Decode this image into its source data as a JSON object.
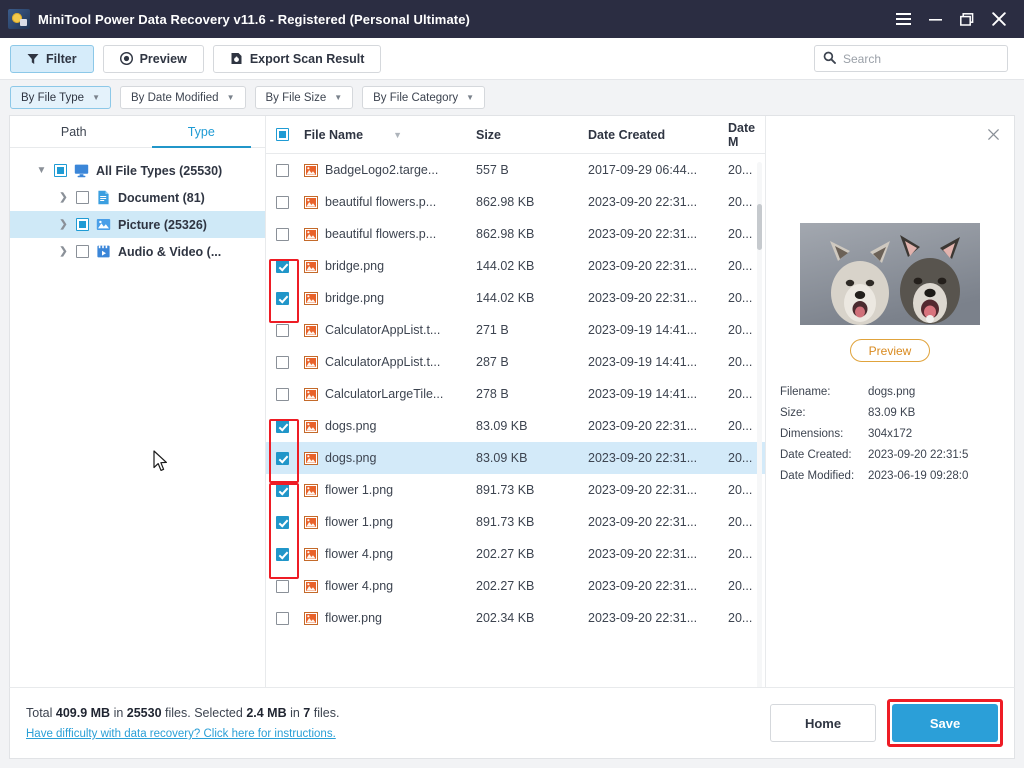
{
  "window": {
    "title": "MiniTool Power Data Recovery v11.6 - Registered (Personal Ultimate)",
    "app_icon": "app-logo-icon",
    "controls": [
      {
        "name": "menu-button",
        "icon": "hamburger-icon"
      },
      {
        "name": "minimize-button",
        "icon": "minimize-icon"
      },
      {
        "name": "restore-button",
        "icon": "restore-icon"
      },
      {
        "name": "close-button",
        "icon": "close-icon"
      }
    ]
  },
  "toolbar": {
    "filter_label": "Filter",
    "preview_label": "Preview",
    "export_label": "Export Scan Result",
    "search_placeholder": "Search",
    "search_value": ""
  },
  "filterbar": {
    "items": [
      {
        "label": "By File Type",
        "active": true
      },
      {
        "label": "By Date Modified",
        "active": false
      },
      {
        "label": "By File Size",
        "active": false
      },
      {
        "label": "By File Category",
        "active": false
      }
    ]
  },
  "tree": {
    "tabs": [
      {
        "label": "Path",
        "active": false
      },
      {
        "label": "Type",
        "active": true
      }
    ],
    "items": [
      {
        "label": "All File Types (25530)",
        "depth": 0,
        "check": "partial",
        "twisty": "down",
        "icon": "monitor-icon",
        "selected": false
      },
      {
        "label": "Document (81)",
        "depth": 1,
        "check": "unchecked",
        "twisty": "right",
        "icon": "document-icon",
        "selected": false
      },
      {
        "label": "Picture (25326)",
        "depth": 1,
        "check": "partial",
        "twisty": "right",
        "icon": "picture-icon",
        "selected": true
      },
      {
        "label": "Audio & Video (...",
        "depth": 1,
        "check": "unchecked",
        "twisty": "right",
        "icon": "video-icon",
        "selected": false
      }
    ]
  },
  "filelist": {
    "columns": [
      {
        "key": "name",
        "label": "File Name",
        "sorted": true
      },
      {
        "key": "size",
        "label": "Size"
      },
      {
        "key": "created",
        "label": "Date Created"
      },
      {
        "key": "modified",
        "label": "Date M"
      }
    ],
    "header_check": "partial",
    "rows": [
      {
        "checked": false,
        "name": "BadgeLogo2.targe...",
        "size": "557 B",
        "created": "2017-09-29 06:44...",
        "modified": "20...",
        "selected": false
      },
      {
        "checked": false,
        "name": "beautiful flowers.p...",
        "size": "862.98 KB",
        "created": "2023-09-20 22:31...",
        "modified": "20...",
        "selected": false
      },
      {
        "checked": false,
        "name": "beautiful flowers.p...",
        "size": "862.98 KB",
        "created": "2023-09-20 22:31...",
        "modified": "20...",
        "selected": false
      },
      {
        "checked": true,
        "name": "bridge.png",
        "size": "144.02 KB",
        "created": "2023-09-20 22:31...",
        "modified": "20...",
        "selected": false
      },
      {
        "checked": true,
        "name": "bridge.png",
        "size": "144.02 KB",
        "created": "2023-09-20 22:31...",
        "modified": "20...",
        "selected": false
      },
      {
        "checked": false,
        "name": "CalculatorAppList.t...",
        "size": "271 B",
        "created": "2023-09-19 14:41...",
        "modified": "20...",
        "selected": false
      },
      {
        "checked": false,
        "name": "CalculatorAppList.t...",
        "size": "287 B",
        "created": "2023-09-19 14:41...",
        "modified": "20...",
        "selected": false
      },
      {
        "checked": false,
        "name": "CalculatorLargeTile...",
        "size": "278 B",
        "created": "2023-09-19 14:41...",
        "modified": "20...",
        "selected": false
      },
      {
        "checked": true,
        "name": "dogs.png",
        "size": "83.09 KB",
        "created": "2023-09-20 22:31...",
        "modified": "20...",
        "selected": false
      },
      {
        "checked": true,
        "name": "dogs.png",
        "size": "83.09 KB",
        "created": "2023-09-20 22:31...",
        "modified": "20...",
        "selected": true
      },
      {
        "checked": true,
        "name": "flower 1.png",
        "size": "891.73 KB",
        "created": "2023-09-20 22:31...",
        "modified": "20...",
        "selected": false
      },
      {
        "checked": true,
        "name": "flower 1.png",
        "size": "891.73 KB",
        "created": "2023-09-20 22:31...",
        "modified": "20...",
        "selected": false
      },
      {
        "checked": true,
        "name": "flower 4.png",
        "size": "202.27 KB",
        "created": "2023-09-20 22:31...",
        "modified": "20...",
        "selected": false
      },
      {
        "checked": false,
        "name": "flower 4.png",
        "size": "202.27 KB",
        "created": "2023-09-20 22:31...",
        "modified": "20...",
        "selected": false
      },
      {
        "checked": false,
        "name": "flower.png",
        "size": "202.34 KB",
        "created": "2023-09-20 22:31...",
        "modified": "20...",
        "selected": false
      }
    ]
  },
  "preview": {
    "close_icon": "close-icon",
    "thumbnail_alt": "two-husky-dogs-photo",
    "button_label": "Preview",
    "fields": [
      {
        "label": "Filename:",
        "value": "dogs.png"
      },
      {
        "label": "Size:",
        "value": "83.09 KB"
      },
      {
        "label": "Dimensions:",
        "value": "304x172"
      },
      {
        "label": "Date Created:",
        "value": "2023-09-20 22:31:5"
      },
      {
        "label": "Date Modified:",
        "value": "2023-06-19 09:28:0"
      }
    ]
  },
  "status": {
    "total_prefix": "Total ",
    "total_size": "409.9 MB",
    "total_mid": " in ",
    "total_count": "25530",
    "total_suffix": " files.  Selected ",
    "selected_size": "2.4 MB",
    "selected_mid": " in ",
    "selected_count": "7",
    "selected_suffix": " files.",
    "help_link": "Have difficulty with data recovery? Click here for instructions.",
    "home_label": "Home",
    "save_label": "Save"
  },
  "colors": {
    "titlebar": "#2b2d42",
    "accent": "#2196c9",
    "save": "#2b9fd8",
    "highlight_red": "#ee1c25",
    "row_selected": "#d3eaf9",
    "tree_selected": "#cfe9f7",
    "link": "#2a9fd6",
    "preview_btn": "#d98a1f"
  }
}
